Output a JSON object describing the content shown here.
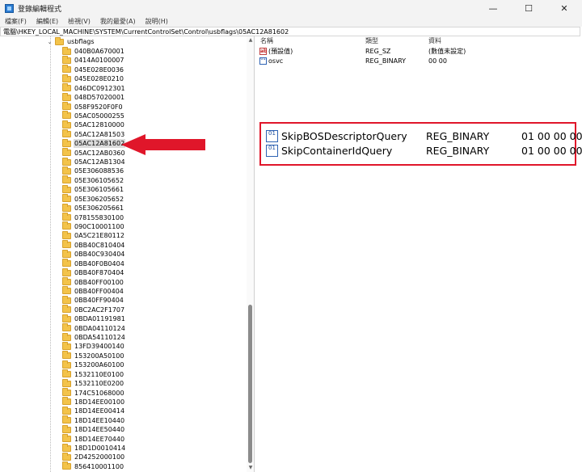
{
  "window": {
    "title": "登錄編輯程式",
    "controls": {
      "minimize": "—",
      "maximize": "☐",
      "close": "✕"
    }
  },
  "menu": [
    {
      "id": "file",
      "label": "檔案(F)"
    },
    {
      "id": "edit",
      "label": "編輯(E)"
    },
    {
      "id": "view",
      "label": "檢視(V)"
    },
    {
      "id": "favorites",
      "label": "我的最愛(A)"
    },
    {
      "id": "help",
      "label": "說明(H)"
    }
  ],
  "address": "電腦\\HKEY_LOCAL_MACHINE\\SYSTEM\\CurrentControlSet\\Control\\usbflags\\05AC12A81602",
  "tree": {
    "parent": "usbflags",
    "selected": "05AC12A81602",
    "children": [
      "040B0A670001",
      "0414A0100007",
      "045E028E0036",
      "045E028E0210",
      "046DC0912301",
      "048D57020001",
      "058F9520F0F0",
      "05AC05000255",
      "05AC12810000",
      "05AC12A81503",
      "05AC12A81602",
      "05AC12AB0360",
      "05AC12AB1304",
      "05E306088536",
      "05E306105652",
      "05E306105661",
      "05E306205652",
      "05E306205661",
      "078155830100",
      "090C10001100",
      "0A5C21E80112",
      "0BB40C810404",
      "0BB40C930404",
      "0BB40F0B0404",
      "0BB40F870404",
      "0BB40FF00100",
      "0BB40FF00404",
      "0BB40FF90404",
      "0BC2AC2F1707",
      "0BDA01191981",
      "0BDA04110124",
      "0BDA54110124",
      "13FD39400140",
      "153200A50100",
      "153200A60100",
      "1532110E0100",
      "1532110E0200",
      "174C51068000",
      "18D14EE00100",
      "18D14EE00414",
      "18D14EE10440",
      "18D14EE50440",
      "18D14EE70440",
      "18D1D0010414",
      "2D4252000100",
      "856410001100"
    ]
  },
  "values_pane": {
    "headers": {
      "name": "名稱",
      "type": "類型",
      "data": "資料"
    },
    "rows": [
      {
        "icon": "string-value-icon",
        "name": "(預設值)",
        "type": "REG_SZ",
        "data": "(數值未設定)"
      },
      {
        "icon": "binary-value-icon",
        "name": "osvc",
        "type": "REG_BINARY",
        "data": "00 00"
      }
    ]
  },
  "highlight": {
    "rows": [
      {
        "name": "SkipBOSDescriptorQuery",
        "type": "REG_BINARY",
        "data": "01 00 00 00"
      },
      {
        "name": "SkipContainerIdQuery",
        "type": "REG_BINARY",
        "data": "01 00 00 00"
      }
    ],
    "box_color": "#e0162a"
  },
  "arrow_color": "#e0162a",
  "icons": {
    "string": "ab",
    "binary": "01"
  }
}
